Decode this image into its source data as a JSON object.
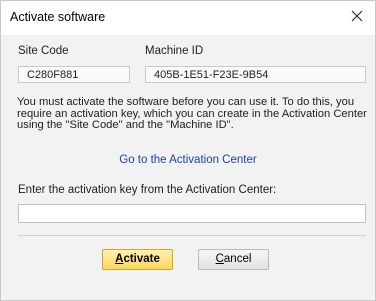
{
  "window": {
    "title": "Activate software"
  },
  "site_code": {
    "label": "Site Code",
    "value": "C280F881"
  },
  "machine_id": {
    "label": "Machine ID",
    "value": "405B-1E51-F23E-9B54"
  },
  "info": {
    "line1": "You must activate the software before you can use it. To do this, you",
    "line2": "require an activation key, which you can create in the Activation Center",
    "line3": "using the \"Site Code\" and the \"Machine ID\"."
  },
  "link": {
    "label": "Go to the Activation Center"
  },
  "activation_key": {
    "label": "Enter the activation key from the Activation Center:",
    "value": ""
  },
  "buttons": {
    "activate_mnemonic": "A",
    "activate_rest": "ctivate",
    "cancel_mnemonic": "C",
    "cancel_rest": "ancel"
  },
  "icons": {
    "close": "close-icon"
  },
  "colors": {
    "link": "#1f3fb8",
    "activate_button": "#fcd55d",
    "dialog_background": "#f2f2f2"
  }
}
